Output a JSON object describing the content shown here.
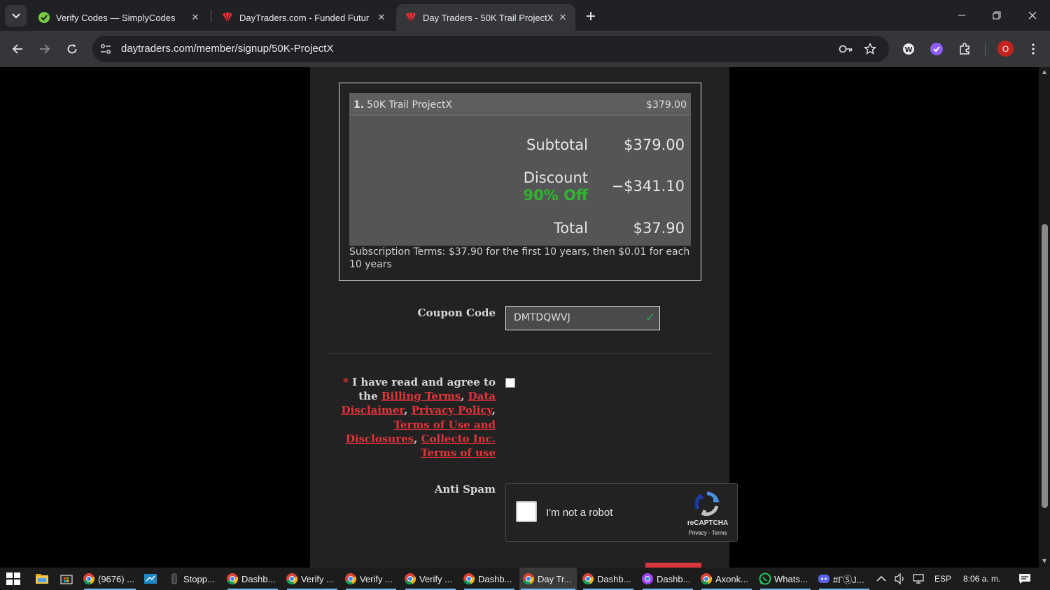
{
  "browser": {
    "tabs": [
      {
        "title": "Verify Codes — SimplyCodes",
        "favicon": "simplycodes-icon"
      },
      {
        "title": "DayTraders.com - Funded Futur",
        "favicon": "daytraders-icon"
      },
      {
        "title": "Day Traders - 50K Trail ProjectX",
        "favicon": "daytraders-icon",
        "active": true
      }
    ],
    "url": "daytraders.com/member/signup/50K-ProjectX",
    "profile_badge": "O"
  },
  "cart": {
    "item": {
      "number": "1.",
      "name": "50K Trail ProjectX",
      "price": "$379.00"
    },
    "subtotal_label": "Subtotal",
    "subtotal_value": "$379.00",
    "discount_label": "Discount",
    "discount_percent": "90% Off",
    "discount_value": "−$341.10",
    "total_label": "Total",
    "total_value": "$37.90",
    "subscription_terms": "Subscription Terms: $37.90 for the first 10 years, then $0.01 for each 10 years"
  },
  "coupon": {
    "label": "Coupon Code",
    "value": "DMTDQWVJ"
  },
  "agreement": {
    "required_mark": "*",
    "text_start": "I have read and agree to the",
    "links": [
      "Billing Terms",
      "Data Disclaimer",
      "Privacy Policy",
      "Terms of Use and Disclosures",
      "Collecto Inc. Terms of use"
    ]
  },
  "antispam": {
    "label": "Anti Spam",
    "checkbox_text": "I'm not a robot",
    "brand": "reCAPTCHA",
    "privacy_terms": "Privacy - Terms"
  },
  "taskbar": {
    "apps": [
      {
        "label": "(9676) ...",
        "icon": "chrome-icon"
      },
      {
        "label": "Stopp...",
        "icon": "app-icon"
      },
      {
        "label": "Dashb...",
        "icon": "chrome-icon"
      },
      {
        "label": "Verify ...",
        "icon": "chrome-icon"
      },
      {
        "label": "Verify ...",
        "icon": "chrome-icon"
      },
      {
        "label": "Verify ...",
        "icon": "chrome-icon"
      },
      {
        "label": "Dashb...",
        "icon": "chrome-icon"
      },
      {
        "label": "Day Tr...",
        "icon": "chrome-icon",
        "active": true
      },
      {
        "label": "Dashb...",
        "icon": "chrome-icon"
      },
      {
        "label": "Dashb...",
        "icon": "chrome-icon"
      },
      {
        "label": "Axonk...",
        "icon": "chrome-icon"
      },
      {
        "label": "Whats...",
        "icon": "whatsapp-icon"
      },
      {
        "label": "#ГⓈJ...",
        "icon": "discord-icon"
      }
    ],
    "language": "ESP",
    "time": "8:06 a. m."
  },
  "colors": {
    "accent_red": "#e0353a",
    "discount_green": "#2fb52f",
    "panel_bg": "#222222"
  }
}
